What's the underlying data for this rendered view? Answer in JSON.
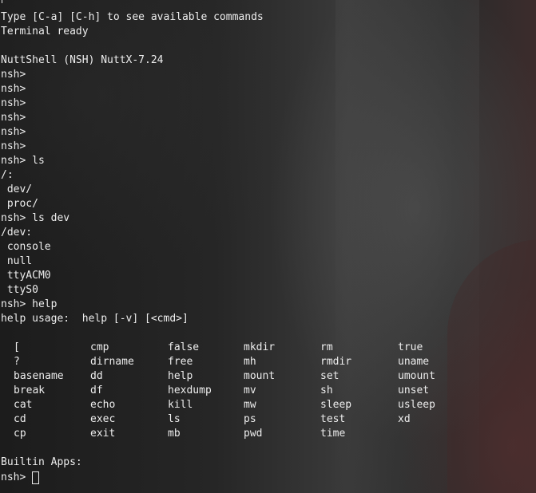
{
  "terminal": {
    "header": [
      "Type [C-a] [C-h] to see available commands",
      "Terminal ready",
      "",
      "NuttShell (NSH) NuttX-7.24",
      "nsh>",
      "nsh>",
      "nsh>",
      "nsh>",
      "nsh>",
      "nsh>",
      "nsh> ls",
      "/:",
      " dev/",
      " proc/",
      "nsh> ls dev",
      "/dev:",
      " console",
      " null",
      " ttyACM0",
      " ttyS0",
      "nsh> help",
      "help usage:  help [-v] [<cmd>]"
    ],
    "commands": [
      [
        "[",
        "cmp",
        "false",
        "mkdir",
        "rm",
        "true"
      ],
      [
        "?",
        "dirname",
        "free",
        "mh",
        "rmdir",
        "uname"
      ],
      [
        "basename",
        "dd",
        "help",
        "mount",
        "set",
        "umount"
      ],
      [
        "break",
        "df",
        "hexdump",
        "mv",
        "sh",
        "unset"
      ],
      [
        "cat",
        "echo",
        "kill",
        "mw",
        "sleep",
        "usleep"
      ],
      [
        "cd",
        "exec",
        "ls",
        "ps",
        "test",
        "xd"
      ],
      [
        "cp",
        "exit",
        "mb",
        "pwd",
        "time",
        ""
      ]
    ],
    "builtin_label": "Builtin Apps:",
    "prompt": "nsh>",
    "text_color": "#ededed"
  }
}
